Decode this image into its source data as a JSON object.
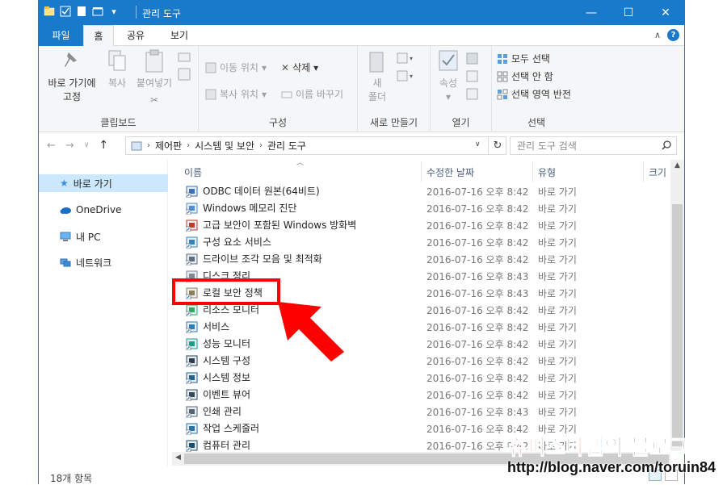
{
  "window": {
    "title": "관리 도구",
    "buttons": {
      "minimize": "—",
      "maximize": "☐",
      "close": "✕"
    }
  },
  "ribbon_tabs": [
    "파일",
    "홈",
    "공유",
    "보기"
  ],
  "ribbon": {
    "clipboard": {
      "pin": "바로 가기에 고정",
      "pin_line1": "바로 가기에",
      "pin_line2": "고정",
      "copy": "복사",
      "paste": "붙여넣기",
      "label": "클립보드"
    },
    "organize": {
      "move_to": "이동 위치",
      "delete": "삭제",
      "copy_to": "복사 위치",
      "rename": "이름 바꾸기",
      "label": "구성"
    },
    "new": {
      "new_folder_line1": "새",
      "new_folder_line2": "폴더",
      "label": "새로 만들기"
    },
    "open": {
      "properties": "속성",
      "label": "열기"
    },
    "select": {
      "select_all": "모두 선택",
      "select_none": "선택 안 함",
      "invert": "선택 영역 반전",
      "label": "선택"
    }
  },
  "address": {
    "crumbs": [
      "제어판",
      "시스템 및 보안",
      "관리 도구"
    ],
    "search_placeholder": "관리 도구 검색"
  },
  "nav_pane": [
    {
      "label": "바로 가기",
      "icon": "star-icon",
      "selected": true
    },
    {
      "label": "OneDrive",
      "icon": "cloud-icon",
      "selected": false
    },
    {
      "label": "내 PC",
      "icon": "computer-icon",
      "selected": false
    },
    {
      "label": "네트워크",
      "icon": "network-icon",
      "selected": false
    }
  ],
  "columns": {
    "name": "이름",
    "modified": "수정한 날짜",
    "type": "유형",
    "size": "크기"
  },
  "files": [
    {
      "name": "ODBC 데이터 원본(64비트)",
      "date": "2016-07-16 오후 8:42",
      "type": "바로 가기"
    },
    {
      "name": "Windows 메모리 진단",
      "date": "2016-07-16 오후 8:42",
      "type": "바로 가기"
    },
    {
      "name": "고급 보안이 포함된 Windows 방화벽",
      "date": "2016-07-16 오후 8:42",
      "type": "바로 가기"
    },
    {
      "name": "구성 요소 서비스",
      "date": "2016-07-16 오후 8:42",
      "type": "바로 가기"
    },
    {
      "name": "드라이브 조각 모음 및 최적화",
      "date": "2016-07-16 오후 8:42",
      "type": "바로 가기"
    },
    {
      "name": "디스크 정리",
      "date": "2016-07-16 오후 8:43",
      "type": "바로 가기"
    },
    {
      "name": "로컬 보안 정책",
      "date": "2016-07-16 오후 8:43",
      "type": "바로 가기"
    },
    {
      "name": "리소스 모니터",
      "date": "2016-07-16 오후 8:42",
      "type": "바로 가기"
    },
    {
      "name": "서비스",
      "date": "2016-07-16 오후 8:42",
      "type": "바로 가기"
    },
    {
      "name": "성능 모니터",
      "date": "2016-07-16 오후 8:42",
      "type": "바로 가기"
    },
    {
      "name": "시스템 구성",
      "date": "2016-07-16 오후 8:42",
      "type": "바로 가기"
    },
    {
      "name": "시스템 정보",
      "date": "2016-07-16 오후 8:42",
      "type": "바로 가기"
    },
    {
      "name": "이벤트 뷰어",
      "date": "2016-07-16 오후 8:42",
      "type": "바로 가기"
    },
    {
      "name": "인쇄 관리",
      "date": "2016-07-16 오후 8:43",
      "type": "바로 가기"
    },
    {
      "name": "작업 스케줄러",
      "date": "2016-07-16 오후 8:42",
      "type": "바로 가기"
    },
    {
      "name": "컴퓨터 관리",
      "date": "2016-07-16 오후 8:42",
      "type": "바로 가기"
    }
  ],
  "status": {
    "item_count": "18개 항목"
  },
  "watermark": {
    "blog_name": "슈퍼스타쌤의 블로그",
    "parts": [
      "슈",
      "퍼",
      "스",
      "타",
      "쌤",
      "의 블로그"
    ],
    "url": "http://blog.naver.com/toruin84"
  },
  "colors": {
    "accent": "#1979ca",
    "highlight": "#ff0000",
    "selected_nav": "#cce8ff"
  }
}
